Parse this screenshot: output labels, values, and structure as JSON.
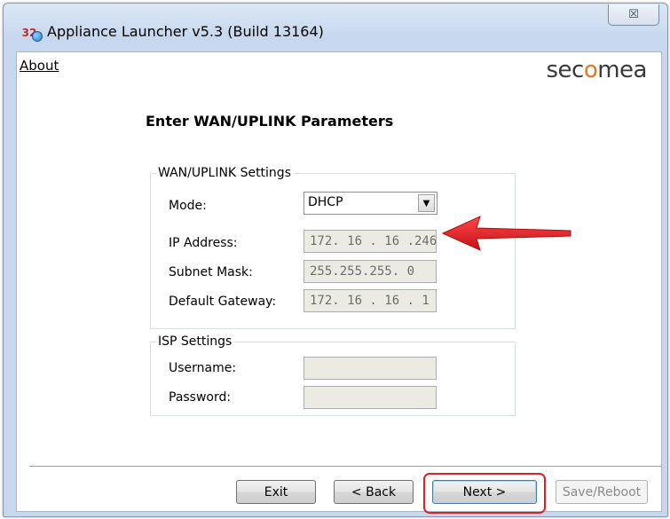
{
  "window": {
    "title": "Appliance Launcher v5.3 (Build 13164)",
    "icon_name": "appliance-launcher-icon",
    "icon_text": "32",
    "close_glyph": "☒"
  },
  "menu": {
    "about_label": "About"
  },
  "brand": {
    "logo_text_prefix": "sec",
    "logo_text_o": "o",
    "logo_text_suffix": "mea",
    "accent_color": "#e87722"
  },
  "page": {
    "heading": "Enter WAN/UPLINK Parameters"
  },
  "wan_settings": {
    "legend": "WAN/UPLINK Settings",
    "mode": {
      "label": "Mode:",
      "value": "DHCP"
    },
    "ip_address": {
      "label": "IP Address:",
      "value": "172. 16 . 16 .246"
    },
    "subnet_mask": {
      "label": "Subnet Mask:",
      "value": "255.255.255. 0"
    },
    "default_gateway": {
      "label": "Default Gateway:",
      "value": "172. 16 . 16 . 1"
    }
  },
  "isp_settings": {
    "legend": "ISP Settings",
    "username": {
      "label": "Username:",
      "value": ""
    },
    "password": {
      "label": "Password:",
      "value": ""
    }
  },
  "buttons": {
    "exit": "Exit",
    "back": "< Back",
    "next": "Next >",
    "save_reboot": "Save/Reboot"
  },
  "annotations": {
    "arrow_color": "#e0161d",
    "highlight_color": "#d8232a"
  }
}
